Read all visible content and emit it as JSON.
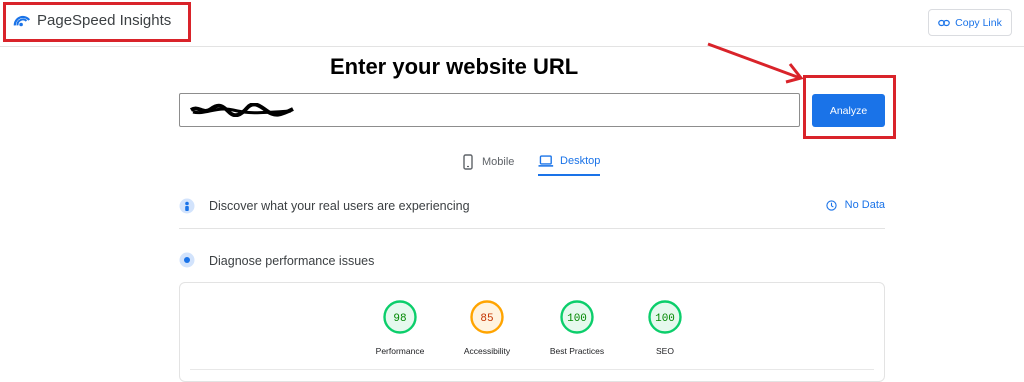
{
  "app": {
    "name": "PageSpeed Insights",
    "copy_link_label": "Copy Link"
  },
  "annotation": {
    "heading": "Enter your website URL"
  },
  "search": {
    "value": "",
    "analyze_label": "Analyze"
  },
  "tabs": [
    {
      "label": "Mobile",
      "icon": "phone-icon",
      "active": false
    },
    {
      "label": "Desktop",
      "icon": "laptop-icon",
      "active": true
    }
  ],
  "field_data": {
    "label": "Discover what your real users are experiencing",
    "status": "No Data"
  },
  "lab_data": {
    "label": "Diagnose performance issues"
  },
  "scores": [
    {
      "label": "Performance",
      "value": "98",
      "color": "#0cce6b",
      "text_color": "#008800"
    },
    {
      "label": "Accessibility",
      "value": "85",
      "color": "#ffa400",
      "text_color": "#c33300"
    },
    {
      "label": "Best Practices",
      "value": "100",
      "color": "#0cce6b",
      "text_color": "#008800"
    },
    {
      "label": "SEO",
      "value": "100",
      "color": "#0cce6b",
      "text_color": "#008800"
    }
  ],
  "colors": {
    "accent": "#1a73e8",
    "highlight": "#d9232a"
  }
}
